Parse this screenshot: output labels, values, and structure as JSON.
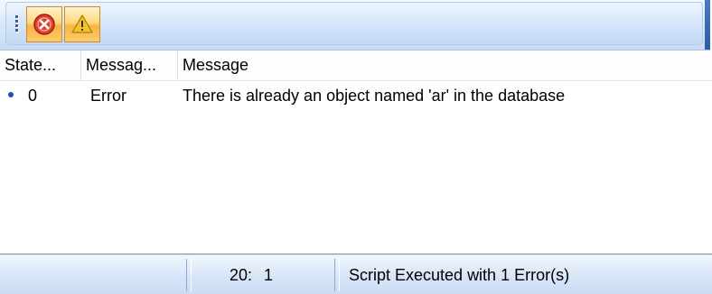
{
  "toolbar": {
    "buttons": [
      {
        "name": "errors",
        "icon": "error-icon"
      },
      {
        "name": "warnings",
        "icon": "warning-icon"
      }
    ]
  },
  "list": {
    "columns": [
      "State...",
      "Messag...",
      "Message"
    ],
    "rows": [
      {
        "state": "0",
        "type": "Error",
        "message": "There is already an object named 'ar' in the database"
      }
    ]
  },
  "status": {
    "line": "20:",
    "column": "1",
    "text": "Script Executed with 1 Error(s)"
  },
  "colors": {
    "toolbar_button": "#ffcc6a",
    "error_icon": "#e2412b",
    "warning_icon": "#f2c12e",
    "row_bullet": "#1a4fb5"
  }
}
